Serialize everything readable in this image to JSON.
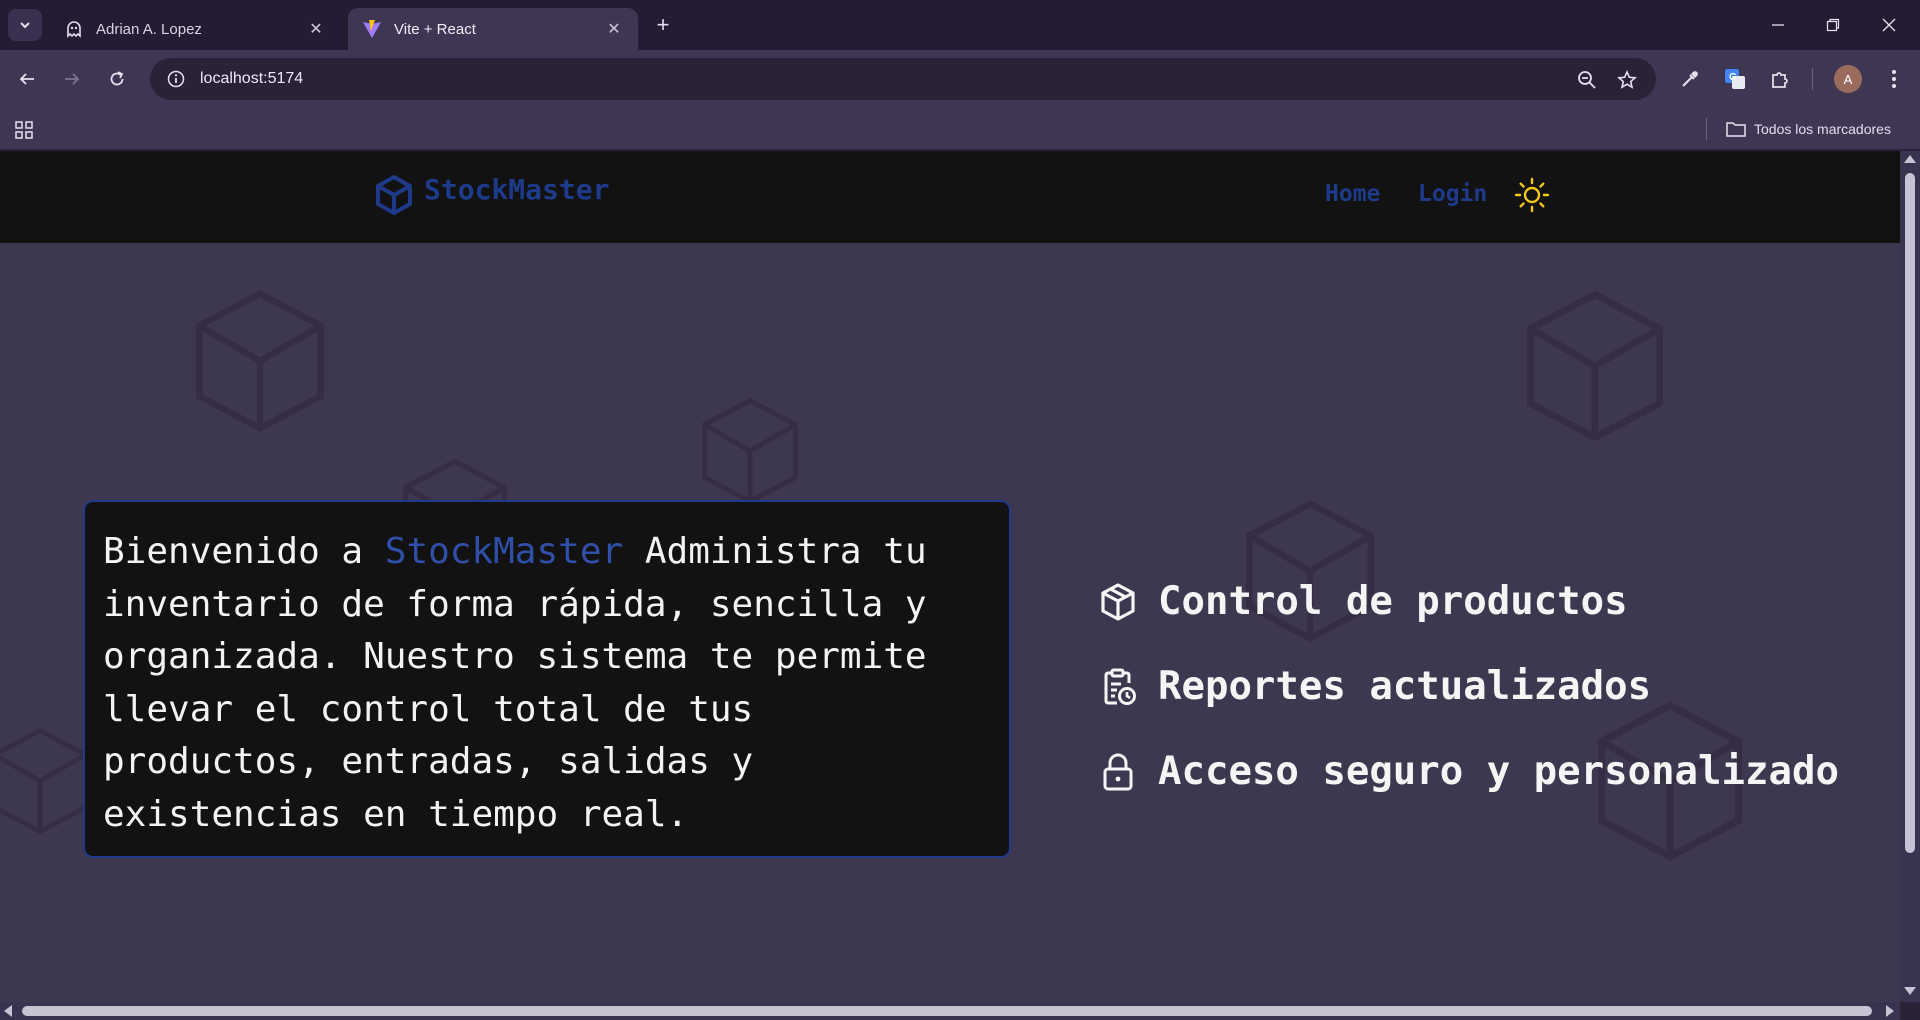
{
  "browser": {
    "tabs": [
      {
        "title": "Adrian A. Lopez",
        "icon": "ghost-icon",
        "active": false
      },
      {
        "title": "Vite + React",
        "icon": "vite-icon",
        "active": true
      }
    ],
    "url": "localhost:5174",
    "avatar_letter": "A",
    "bookmarks_label": "Todos los marcadores"
  },
  "site": {
    "brand": "StockMaster",
    "nav": {
      "home": "Home",
      "login": "Login"
    },
    "welcome": {
      "prefix": "Bienvenido a ",
      "brand": "StockMaster",
      "body": " Administra tu inventario de forma rápida, sencilla y organizada. Nuestro sistema te permite llevar el control total de tus productos, entradas, salidas y existencias en tiempo real."
    },
    "features": [
      {
        "icon": "box-icon",
        "label": "Control de productos"
      },
      {
        "icon": "clipboard-clock-icon",
        "label": "Reportes actualizados"
      },
      {
        "icon": "lock-icon",
        "label": "Acceso seguro y personalizado"
      }
    ]
  },
  "colors": {
    "brand_blue": "#1e3a8a",
    "nav_bg": "#121212",
    "page_bg": "#3e3750",
    "sun_yellow": "#f5c518"
  }
}
